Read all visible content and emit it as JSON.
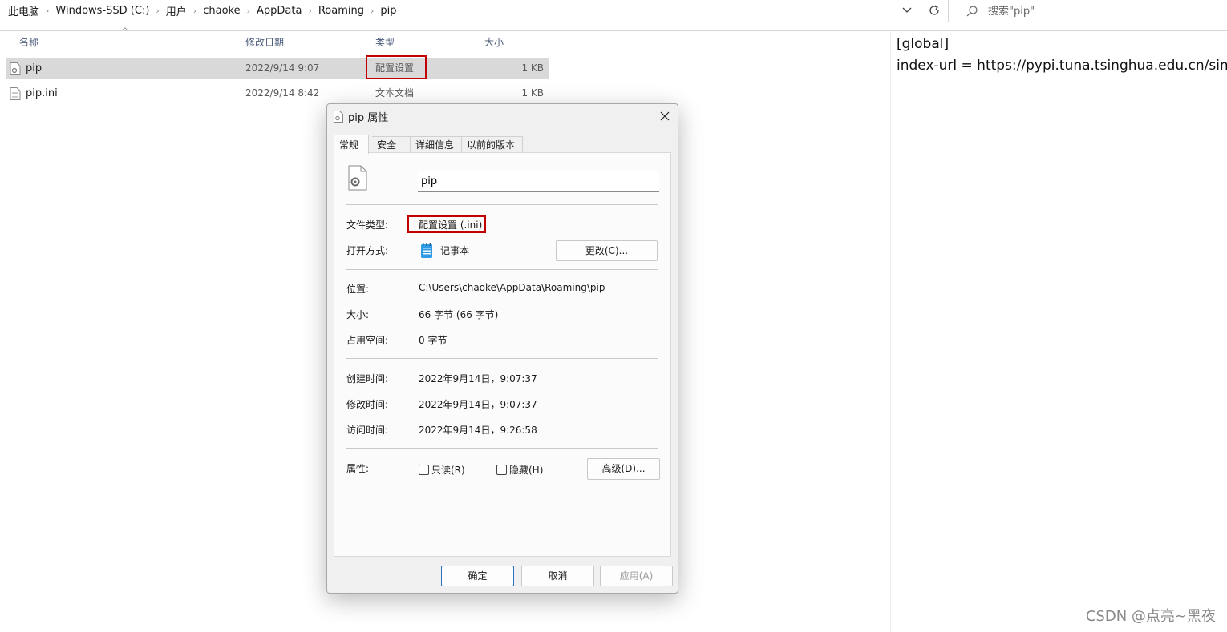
{
  "explorer": {
    "breadcrumb": [
      "此电脑",
      "Windows-SSD (C:)",
      "用户",
      "chaoke",
      "AppData",
      "Roaming",
      "pip"
    ],
    "search_placeholder": "搜索\"pip\"",
    "columns": {
      "name": "名称",
      "modified": "修改日期",
      "type": "类型",
      "size": "大小"
    },
    "files": [
      {
        "name": "pip",
        "modified": "2022/9/14 9:07",
        "type": "配置设置",
        "size": "1 KB",
        "selected": true
      },
      {
        "name": "pip.ini",
        "modified": "2022/9/14 8:42",
        "type": "文本文档",
        "size": "1 KB",
        "selected": false
      }
    ]
  },
  "preview": {
    "lines": [
      "[global]",
      "index-url = https://pypi.tuna.tsinghua.edu.cn/simple"
    ]
  },
  "dialog": {
    "title": "pip 属性",
    "tabs": [
      "常规",
      "安全",
      "详细信息",
      "以前的版本"
    ],
    "active_tab": "常规",
    "filename": "pip",
    "file_type_label": "文件类型:",
    "file_type_value": "配置设置 (.ini)",
    "open_with_label": "打开方式:",
    "open_with_value": "记事本",
    "change_button": "更改(C)...",
    "location_label": "位置:",
    "location_value": "C:\\Users\\chaoke\\AppData\\Roaming\\pip",
    "size_label": "大小:",
    "size_value": "66 字节 (66 字节)",
    "disk_size_label": "占用空间:",
    "disk_size_value": "0 字节",
    "created_label": "创建时间:",
    "created_value": "2022年9月14日，9:07:37",
    "modified_label": "修改时间:",
    "modified_value": "2022年9月14日，9:07:37",
    "accessed_label": "访问时间:",
    "accessed_value": "2022年9月14日，9:26:58",
    "attributes_label": "属性:",
    "readonly_label": "只读(R)",
    "hidden_label": "隐藏(H)",
    "advanced_button": "高级(D)...",
    "ok_button": "确定",
    "cancel_button": "取消",
    "apply_button": "应用(A)"
  },
  "watermark": "CSDN @点亮~黑夜",
  "colors": {
    "highlight_border": "#c00000",
    "selected_row": "#d9d9d9",
    "ok_border": "#2a72c8"
  }
}
